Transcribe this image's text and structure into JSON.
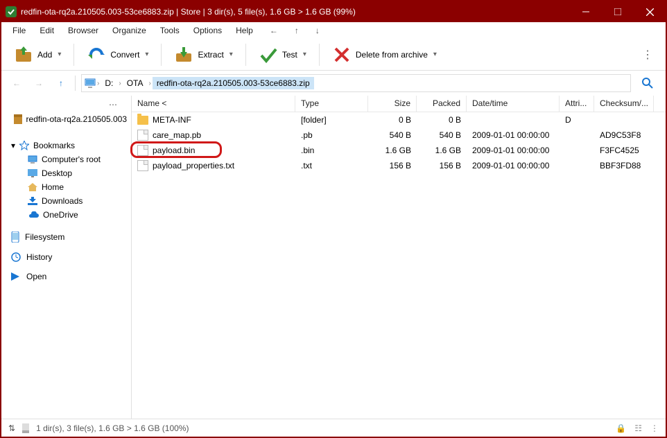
{
  "title": "redfin-ota-rq2a.210505.003-53ce6883.zip | Store | 3 dir(s), 5 file(s), 1.6 GB > 1.6 GB (99%)",
  "menu": [
    "File",
    "Edit",
    "Browser",
    "Organize",
    "Tools",
    "Options",
    "Help"
  ],
  "toolbar": {
    "add": "Add",
    "convert": "Convert",
    "extract": "Extract",
    "test": "Test",
    "delete": "Delete from archive"
  },
  "crumbs": {
    "drive": "D:",
    "folder": "OTA",
    "archive": "redfin-ota-rq2a.210505.003-53ce6883.zip"
  },
  "sidebar": {
    "archive": "redfin-ota-rq2a.210505.003",
    "bookmarks": "Bookmarks",
    "items": [
      "Computer's root",
      "Desktop",
      "Home",
      "Downloads",
      "OneDrive"
    ],
    "filesystem": "Filesystem",
    "history": "History",
    "open": "Open"
  },
  "columns": {
    "name": "Name <",
    "type": "Type",
    "size": "Size",
    "packed": "Packed",
    "date": "Date/time",
    "attr": "Attri...",
    "check": "Checksum/..."
  },
  "rows": [
    {
      "name": "META-INF",
      "type": "[folder]",
      "size": "0 B",
      "packed": "0 B",
      "date": "",
      "attr": "D",
      "check": "",
      "icon": "folder"
    },
    {
      "name": "care_map.pb",
      "type": ".pb",
      "size": "540 B",
      "packed": "540 B",
      "date": "2009-01-01 00:00:00",
      "attr": "",
      "check": "AD9C53F8",
      "icon": "file"
    },
    {
      "name": "payload.bin",
      "type": ".bin",
      "size": "1.6 GB",
      "packed": "1.6 GB",
      "date": "2009-01-01 00:00:00",
      "attr": "",
      "check": "F3FC4525",
      "icon": "file",
      "ring": true
    },
    {
      "name": "payload_properties.txt",
      "type": ".txt",
      "size": "156 B",
      "packed": "156 B",
      "date": "2009-01-01 00:00:00",
      "attr": "",
      "check": "BBF3FD88",
      "icon": "file"
    }
  ],
  "status": "1 dir(s), 3 file(s), 1.6 GB > 1.6 GB (100%)"
}
